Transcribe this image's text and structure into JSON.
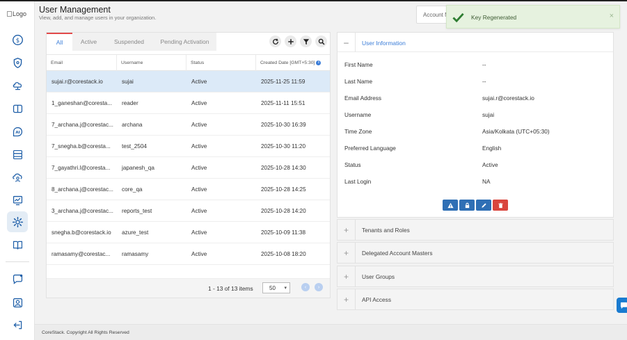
{
  "brand": {
    "logo_alt": "Logo"
  },
  "header": {
    "title": "User Management",
    "subtitle": "View, add, and manage users in your organization.",
    "account_selector": "Account M"
  },
  "sidebar": {
    "items": [
      {
        "icon": "dollar-icon"
      },
      {
        "icon": "shield-icon"
      },
      {
        "icon": "cloud-network-icon"
      },
      {
        "icon": "bracket-box-icon"
      },
      {
        "icon": "ai-icon"
      },
      {
        "icon": "server-icon"
      },
      {
        "icon": "cloud-person-icon"
      },
      {
        "icon": "monitor-chart-icon"
      },
      {
        "icon": "gear-icon",
        "active": true
      },
      {
        "icon": "book-icon"
      }
    ],
    "bottom_items": [
      {
        "icon": "chat-icon"
      },
      {
        "icon": "user-icon"
      },
      {
        "icon": "logout-icon"
      }
    ]
  },
  "tabs": [
    "All",
    "Active",
    "Suspended",
    "Pending Activation"
  ],
  "toolbar": {
    "icons": [
      "refresh-icon",
      "plus-icon",
      "filter-icon",
      "search-icon"
    ]
  },
  "table": {
    "columns": [
      "Email",
      "Username",
      "Status",
      "Created Date [GMT+5:30]"
    ],
    "rows": [
      {
        "email": "sujai.r@corestack.io",
        "username": "sujai",
        "status": "Active",
        "created": "2025-11-25 11:59",
        "selected": true
      },
      {
        "email": "1_ganeshan@coresta...",
        "username": "reader",
        "status": "Active",
        "created": "2025-11-11 15:51"
      },
      {
        "email": "7_archana.j@corestac...",
        "username": "archana",
        "status": "Active",
        "created": "2025-10-30 16:39"
      },
      {
        "email": "7_snegha.b@coresta...",
        "username": "test_2504",
        "status": "Active",
        "created": "2025-10-30 11:20"
      },
      {
        "email": "7_gayathri.l@coresta...",
        "username": "japanesh_qa",
        "status": "Active",
        "created": "2025-10-28 14:30"
      },
      {
        "email": "8_archana.j@corestac...",
        "username": "core_qa",
        "status": "Active",
        "created": "2025-10-28 14:25"
      },
      {
        "email": "3_archana.j@corestac...",
        "username": "reports_test",
        "status": "Active",
        "created": "2025-10-28 14:20"
      },
      {
        "email": "snegha.b@corestack.io",
        "username": "azure_test",
        "status": "Active",
        "created": "2025-10-09 11:38"
      },
      {
        "email": "ramasamy@corestac...",
        "username": "ramasamy",
        "status": "Active",
        "created": "2025-10-08 18:20"
      }
    ]
  },
  "pagination": {
    "summary": "1 - 13 of 13 items",
    "page_size": "50"
  },
  "user_info": {
    "section_title": "User Information",
    "fields": [
      {
        "label": "First Name",
        "value": "--"
      },
      {
        "label": "Last Name",
        "value": "--"
      },
      {
        "label": "Email Address",
        "value": "sujai.r@corestack.io"
      },
      {
        "label": "Username",
        "value": "sujai"
      },
      {
        "label": "Time Zone",
        "value": "Asia/Kolkata (UTC+05:30)"
      },
      {
        "label": "Preferred Language",
        "value": "English"
      },
      {
        "label": "Status",
        "value": "Active"
      },
      {
        "label": "Last Login",
        "value": "NA"
      }
    ],
    "actions": [
      {
        "icon": "warning-icon",
        "color": "#2f6fb5"
      },
      {
        "icon": "lock-icon",
        "color": "#2f6fb5"
      },
      {
        "icon": "pencil-icon",
        "color": "#2f6fb5"
      },
      {
        "icon": "trash-icon",
        "color": "#d9463e"
      }
    ]
  },
  "sections": [
    "Tenants and Roles",
    "Delegated Account Masters",
    "User Groups",
    "API Access"
  ],
  "toast": {
    "message": "Key Regenerated",
    "close": "×"
  },
  "footer": {
    "text": "CoreStack. Copyright All Rights Reserved"
  },
  "colors": {
    "accent": "#3b7dd8",
    "tab_indicator": "#e24b4b",
    "selected_row": "#dceaf8",
    "toast_bg": "#e6f2df",
    "success": "#2e7d32"
  }
}
